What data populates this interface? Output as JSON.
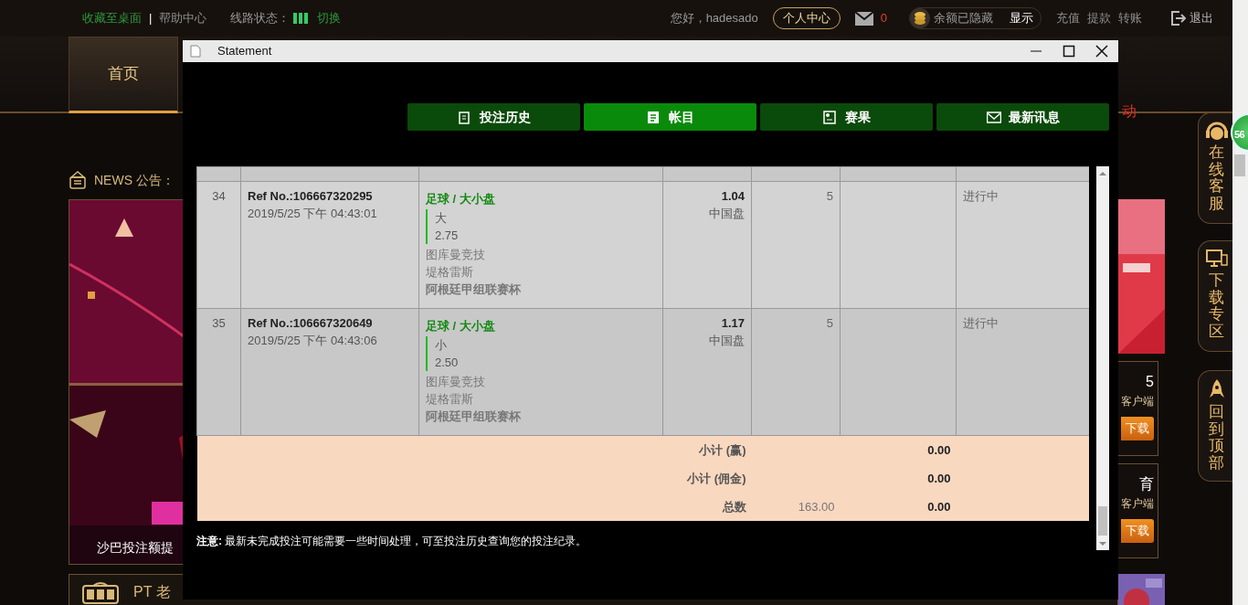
{
  "site": {
    "top_links": [
      {
        "label": "收藏至桌面",
        "kind": "accent"
      },
      {
        "label": "帮助中心",
        "kind": "plain"
      }
    ],
    "separator": "|",
    "line_status": {
      "label": "线路状态：",
      "action": "切换"
    },
    "greeting": "您好，hadesado",
    "profile_button": "个人中心",
    "mail_count": "0",
    "balance": {
      "label": "余额已隐藏",
      "action": "显示"
    },
    "account_links": [
      "充值",
      "提款",
      "转账"
    ],
    "logout": "退出",
    "nav": [
      {
        "label": "首页",
        "selected": true
      }
    ],
    "promo_text": "动",
    "news_label": "NEWS 公告：",
    "banner": {
      "caption": "沙巴投注额提"
    },
    "side_cards": [
      {
        "title": "5",
        "subtitle": "客户端",
        "button": "下载"
      },
      {
        "title": "育",
        "subtitle": "客户端",
        "button": "下载"
      }
    ],
    "game_section": "PT 老",
    "float_buttons": [
      {
        "label": "在线客服",
        "kind": "headset"
      },
      {
        "label": "下载专区",
        "kind": "devices"
      },
      {
        "label": "回到顶部",
        "kind": "rocket"
      }
    ],
    "chat_badge": "56"
  },
  "window": {
    "title": "Statement",
    "tabs": [
      {
        "label": "投注历史",
        "kind": "history",
        "selected": false
      },
      {
        "label": "帐目",
        "kind": "statement",
        "selected": true
      },
      {
        "label": "赛果",
        "kind": "results",
        "selected": false
      },
      {
        "label": "最新讯息",
        "kind": "messages",
        "selected": false
      }
    ],
    "rows": [
      {
        "index": "34",
        "ref": "Ref No.:106667320295",
        "time": "2019/5/25 下午 04:43:01",
        "sport": "足球 / 大小盘",
        "selection": "大",
        "line": "2.75",
        "home": "图库曼竞技",
        "away": "堤格雷斯",
        "league": "阿根廷甲组联赛杯",
        "odds": "1.04",
        "odds_type": "中国盘",
        "stake": "5",
        "status": "进行中"
      },
      {
        "index": "35",
        "ref": "Ref No.:106667320649",
        "time": "2019/5/25 下午 04:43:06",
        "sport": "足球 / 大小盘",
        "selection": "小",
        "line": "2.50",
        "home": "图库曼竞技",
        "away": "堤格雷斯",
        "league": "阿根廷甲组联赛杯",
        "odds": "1.17",
        "odds_type": "中国盘",
        "stake": "5",
        "status": "进行中"
      }
    ],
    "totals": [
      {
        "label": "小计 (赢)",
        "amount": "0.00"
      },
      {
        "label": "小计 (佣金)",
        "amount": "0.00"
      },
      {
        "label": "总数",
        "stake": "163.00",
        "amount": "0.00"
      }
    ],
    "notice": "**注意:** 最新未完成投注可能需要一些时间处理，可至投注历史查询您的投注纪录。"
  }
}
